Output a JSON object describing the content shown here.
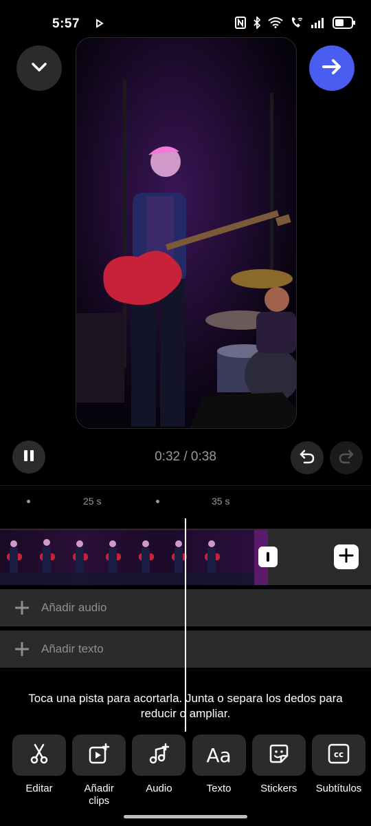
{
  "status_bar": {
    "time": "5:57",
    "icons": [
      "play-indicator-icon",
      "nfc-icon",
      "bluetooth-icon",
      "wifi-icon",
      "wifi-calling-icon",
      "signal-icon",
      "battery-icon"
    ]
  },
  "player": {
    "time_readout": "0:32 / 0:38",
    "state": "playing"
  },
  "timeline": {
    "ruler_labels": [
      "25 s",
      "35 s"
    ],
    "tracks": {
      "audio_label": "Añadir audio",
      "text_label": "Añadir texto"
    }
  },
  "hint_text": "Toca una pista para acortarla. Junta o separa los dedos para reducir o ampliar.",
  "toolbar": {
    "items": [
      {
        "label": "Editar",
        "icon": "scissors-icon"
      },
      {
        "label": "Añadir clips",
        "icon": "add-clip-icon"
      },
      {
        "label": "Audio",
        "icon": "music-add-icon"
      },
      {
        "label": "Texto",
        "icon": "text-icon"
      },
      {
        "label": "Stickers",
        "icon": "sticker-icon"
      },
      {
        "label": "Subtítulos",
        "icon": "captions-icon"
      }
    ]
  },
  "colors": {
    "accent": "#4b5cf0",
    "background": "#000000",
    "track": "#2b2b2b"
  }
}
